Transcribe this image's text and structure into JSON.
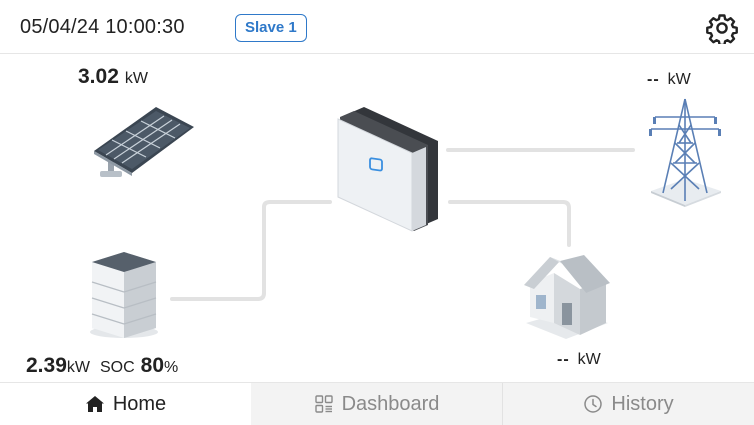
{
  "header": {
    "datetime": "05/04/24 10:00:30",
    "device_badge": "Slave 1",
    "settings_icon": "gear-icon"
  },
  "flow": {
    "pv": {
      "power_value": "3.02",
      "power_unit": "kW",
      "icon": "solar-panel-icon"
    },
    "grid": {
      "power_value": "--",
      "power_unit": "kW",
      "icon": "power-tower-icon"
    },
    "inverter": {
      "icon": "inverter-icon"
    },
    "battery": {
      "power_value": "2.39",
      "power_unit": "kW",
      "soc_label": "SOC",
      "soc_value": "80",
      "soc_unit": "%",
      "icon": "battery-icon"
    },
    "home": {
      "power_value": "--",
      "power_unit": "kW",
      "icon": "house-icon"
    },
    "colors": {
      "active_flow": "#3a8fe0",
      "idle_line": "#e2e2e2"
    }
  },
  "tabs": [
    {
      "label": "Home",
      "icon": "home-icon",
      "active": true
    },
    {
      "label": "Dashboard",
      "icon": "dashboard-icon",
      "active": false
    },
    {
      "label": "History",
      "icon": "clock-icon",
      "active": false
    }
  ],
  "colors": {
    "accent": "#2f79c9",
    "tab_inactive_bg": "#f3f3f3"
  }
}
